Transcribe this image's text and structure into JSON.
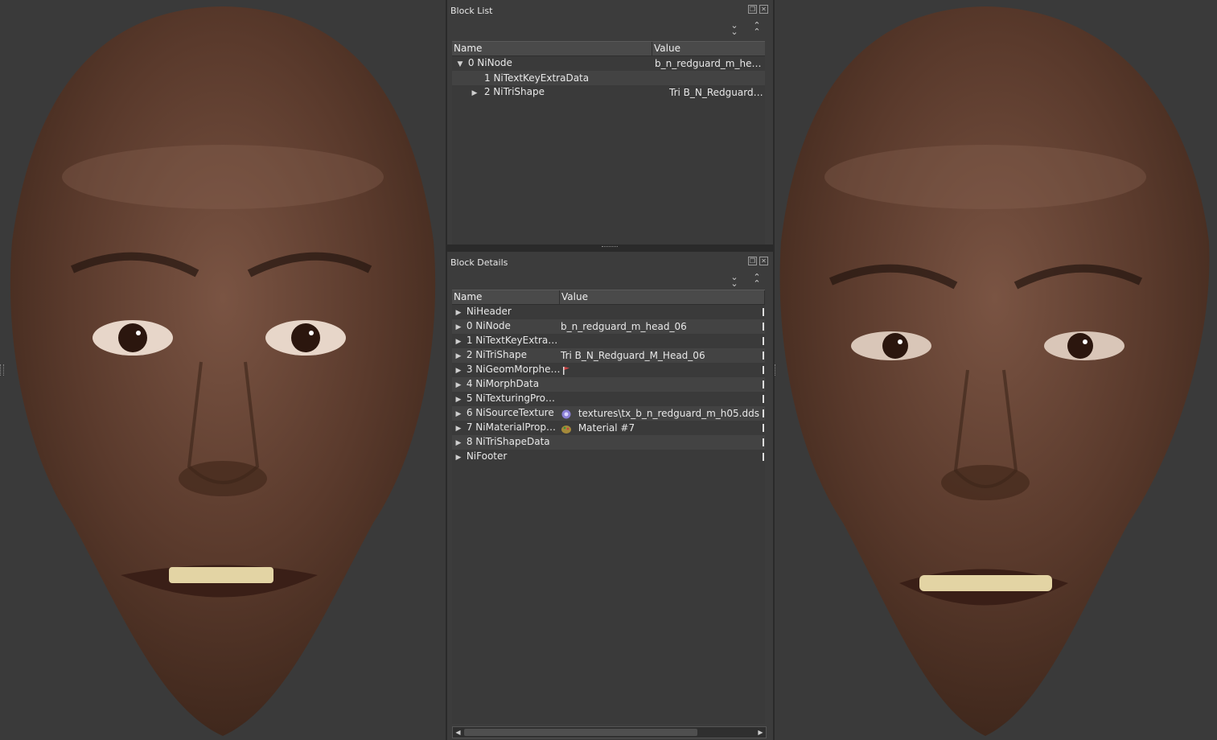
{
  "block_list": {
    "title": "Block List",
    "columns": [
      "Name",
      "Value"
    ],
    "rows": [
      {
        "arrow": "▼",
        "name": "0 NiNode",
        "value": "b_n_redguard_m_head_..."
      },
      {
        "arrow": "",
        "name": "1 NiTextKeyExtraData",
        "value": ""
      },
      {
        "arrow": "▶",
        "name": "2 NiTriShape",
        "value": "Tri B_N_Redguard_M_H..."
      }
    ]
  },
  "block_details": {
    "title": "Block Details",
    "columns": [
      "Name",
      "Value"
    ],
    "rows": [
      {
        "name": "NiHeader",
        "value": "",
        "icon": ""
      },
      {
        "name": "0 NiNode",
        "value": "b_n_redguard_m_head_06",
        "icon": ""
      },
      {
        "name": "1 NiTextKeyExtraD...",
        "value": "",
        "icon": ""
      },
      {
        "name": "2 NiTriShape",
        "value": "Tri B_N_Redguard_M_Head_06",
        "icon": ""
      },
      {
        "name": "3 NiGeomMorpher...",
        "value": "",
        "icon": "flag-icon"
      },
      {
        "name": "4 NiMorphData",
        "value": "",
        "icon": ""
      },
      {
        "name": "5 NiTexturingProp...",
        "value": "",
        "icon": ""
      },
      {
        "name": "6 NiSourceTexture",
        "value": "textures\\tx_b_n_redguard_m_h05.dds",
        "icon": "texture-icon"
      },
      {
        "name": "7 NiMaterialProperty",
        "value": "Material #7",
        "icon": "material-icon"
      },
      {
        "name": "8 NiTriShapeData",
        "value": "",
        "icon": ""
      },
      {
        "name": "NiFooter",
        "value": "",
        "icon": ""
      }
    ]
  },
  "icons": {
    "float": "float-icon",
    "close": "close-icon",
    "expand_all": "expand-all-icon",
    "collapse_all": "collapse-all-icon"
  },
  "colors": {
    "skin": "#5a3a2a",
    "skin_light": "#7a5443",
    "background": "#3a3a3a",
    "panel": "#3c3c3c"
  }
}
